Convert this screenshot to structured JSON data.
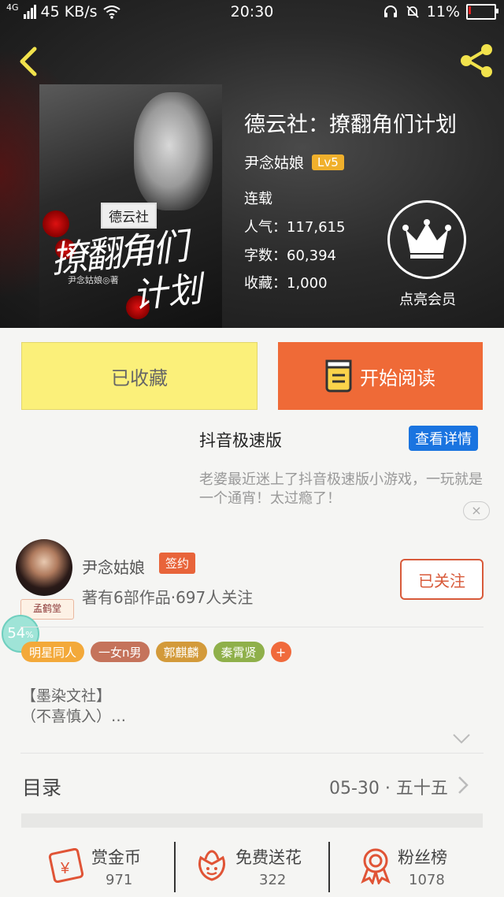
{
  "status_bar": {
    "network": "4G",
    "speed": "45 KB/s",
    "time": "20:30",
    "battery": "11%",
    "battery_level": 0.11
  },
  "book": {
    "title": "德云社：撩翻角们计划",
    "author": "尹念姑娘",
    "level": "Lv5",
    "status": "连载",
    "popularity": "人气：117,615",
    "word_count": "字数：60,394",
    "collections": "收藏：1,000",
    "vip_label": "点亮会员",
    "cover": {
      "tag": "德云社",
      "big_text_1": "撩翻角们",
      "big_text_2": "计划",
      "author_text": "尹念姑娘◎著"
    }
  },
  "actions": {
    "collected_label": "已收藏",
    "read_label": "开始阅读"
  },
  "ad": {
    "title": "抖音极速版",
    "button": "查看详情",
    "description": "老婆最近迷上了抖音极速版小游戏，一玩就是一个通宵！太过瘾了！",
    "close": "×"
  },
  "author_card": {
    "name": "尹念姑娘",
    "badge": "签约",
    "info": "著有6部作品·697人关注",
    "follow_label": "已关注",
    "avatar_tag": "孟鹤堂",
    "percent": "54",
    "percent_unit": "%"
  },
  "tags": [
    {
      "label": "明星同人",
      "color": "#f3a93a"
    },
    {
      "label": "一女n男",
      "color": "#c5735b"
    },
    {
      "label": "郭麒麟",
      "color": "#d39a3a"
    },
    {
      "label": "秦霄贤",
      "color": "#8fb04a"
    }
  ],
  "tag_add": "+",
  "intro": {
    "line1": "【墨染文社】",
    "line2": "（不喜慎入）…"
  },
  "toc": {
    "label": "目录",
    "latest": "05-30 · 五十五"
  },
  "bottom": {
    "reward_label": "赏金币",
    "reward_value": "971",
    "flower_label": "免费送花",
    "flower_value": "322",
    "fans_label": "粉丝榜",
    "fans_value": "1078"
  },
  "colors": {
    "accent_orange": "#ef6a37",
    "collected_yellow": "#fbf07a",
    "ad_blue": "#1a74e0",
    "follow_red": "#d85a3a",
    "level_gold": "#f0b02c"
  }
}
